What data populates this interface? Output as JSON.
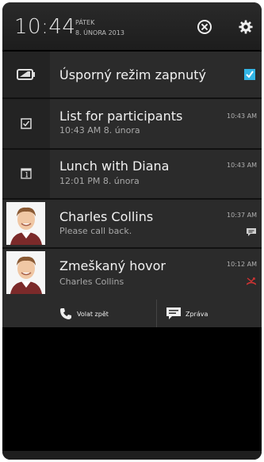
{
  "status_bar": {
    "time": "10:44",
    "day": "PÁTEK",
    "date": "8. ÚNORA 2013"
  },
  "notifications": [
    {
      "title": "Úsporný režim zapnutý"
    },
    {
      "title": "List for participants",
      "subtitle": "10:43 AM 8. února",
      "time": "10:43 AM"
    },
    {
      "title": "Lunch with Diana",
      "subtitle": "12:01 PM 8. února",
      "time": "10:43 AM"
    },
    {
      "title": "Charles Collins",
      "subtitle": "Please call back.",
      "time": "10:37 AM"
    },
    {
      "title": "Zmeškaný hovor",
      "subtitle": "Charles Collins",
      "time": "10:12 AM"
    }
  ],
  "actions": {
    "call_back": "Volat zpět",
    "message": "Zpráva"
  },
  "colors": {
    "accent": "#33b5e5",
    "missed": "#cc3333"
  }
}
